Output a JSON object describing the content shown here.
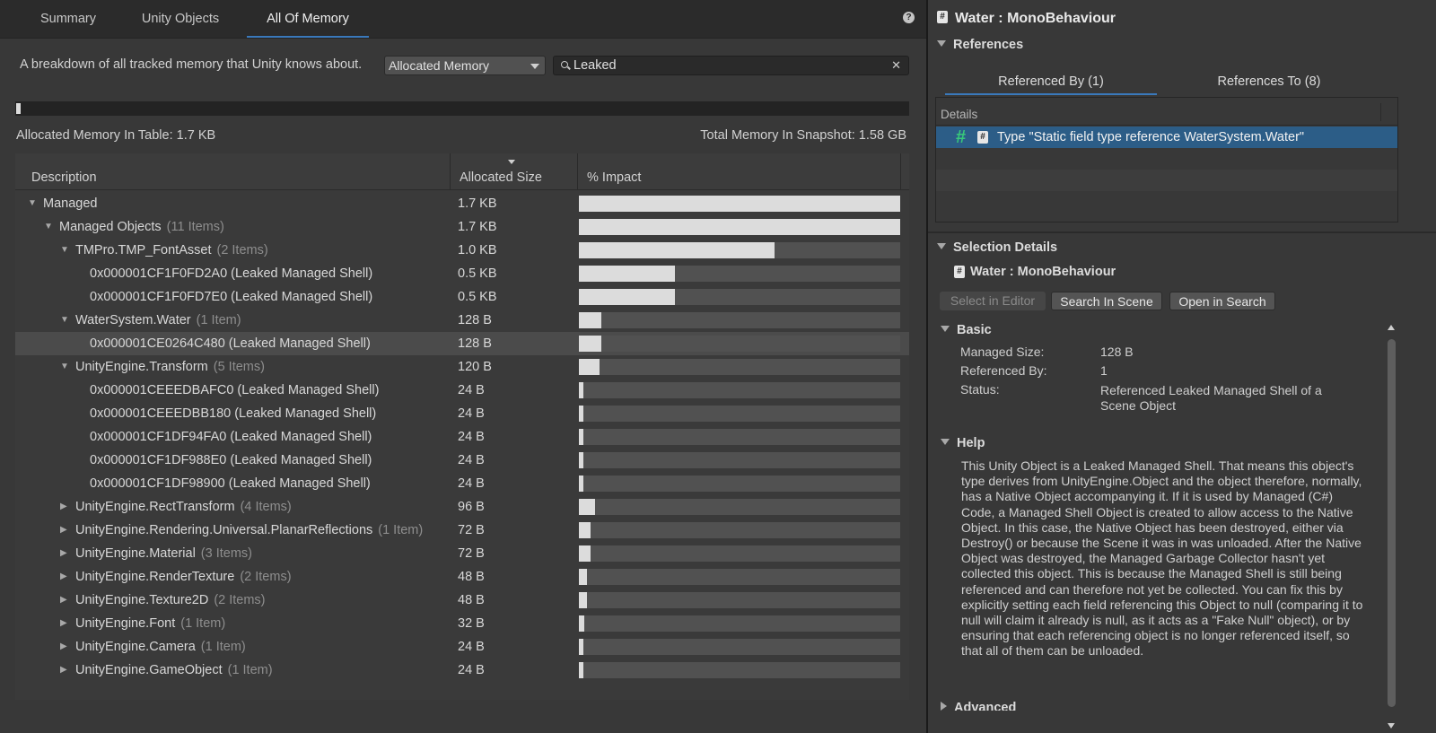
{
  "tabs": [
    {
      "label": "Summary"
    },
    {
      "label": "Unity Objects"
    },
    {
      "label": "All Of Memory"
    }
  ],
  "help_icon": "help-icon",
  "description": "A breakdown of all tracked memory that Unity knows about.",
  "view_dropdown": {
    "value": "Allocated Memory"
  },
  "search": {
    "value": "Leaked",
    "clear": "✕"
  },
  "memory_bar_fraction": 0.0011,
  "summary": {
    "allocated_in_table": "Allocated Memory In Table: 1.7 KB",
    "total_in_snapshot": "Total Memory In Snapshot: 1.58 GB"
  },
  "table": {
    "columns": [
      "Description",
      "Allocated Size",
      "% Impact"
    ],
    "sorted_column": "Allocated Size",
    "rows": [
      {
        "label": "Managed",
        "count": "",
        "size": "1.7 KB",
        "impact": 1.0,
        "depth": 0,
        "expander": "expanded"
      },
      {
        "label": "Managed Objects",
        "count": "(11 Items)",
        "size": "1.7 KB",
        "impact": 1.0,
        "depth": 1,
        "expander": "expanded"
      },
      {
        "label": "TMPro.TMP_FontAsset",
        "count": "(2 Items)",
        "size": "1.0 KB",
        "impact": 0.61,
        "depth": 2,
        "expander": "expanded"
      },
      {
        "label": "0x000001CF1F0FD2A0 (Leaked Managed Shell)",
        "count": "",
        "size": "0.5 KB",
        "impact": 0.3,
        "depth": 3,
        "expander": "none"
      },
      {
        "label": "0x000001CF1F0FD7E0 (Leaked Managed Shell)",
        "count": "",
        "size": "0.5 KB",
        "impact": 0.3,
        "depth": 3,
        "expander": "none"
      },
      {
        "label": "WaterSystem.Water",
        "count": "(1 Item)",
        "size": "128 B",
        "impact": 0.07,
        "depth": 2,
        "expander": "expanded"
      },
      {
        "label": "0x000001CE0264C480 (Leaked Managed Shell)",
        "count": "",
        "size": "128 B",
        "impact": 0.07,
        "depth": 3,
        "expander": "none",
        "selected": true
      },
      {
        "label": "UnityEngine.Transform",
        "count": "(5 Items)",
        "size": "120 B",
        "impact": 0.065,
        "depth": 2,
        "expander": "expanded"
      },
      {
        "label": "0x000001CEEEDBAFC0 (Leaked Managed Shell)",
        "count": "",
        "size": "24 B",
        "impact": 0.014,
        "depth": 3,
        "expander": "none"
      },
      {
        "label": "0x000001CEEEDBB180 (Leaked Managed Shell)",
        "count": "",
        "size": "24 B",
        "impact": 0.014,
        "depth": 3,
        "expander": "none"
      },
      {
        "label": "0x000001CF1DF94FA0 (Leaked Managed Shell)",
        "count": "",
        "size": "24 B",
        "impact": 0.014,
        "depth": 3,
        "expander": "none"
      },
      {
        "label": "0x000001CF1DF988E0 (Leaked Managed Shell)",
        "count": "",
        "size": "24 B",
        "impact": 0.014,
        "depth": 3,
        "expander": "none"
      },
      {
        "label": "0x000001CF1DF98900 (Leaked Managed Shell)",
        "count": "",
        "size": "24 B",
        "impact": 0.014,
        "depth": 3,
        "expander": "none"
      },
      {
        "label": "UnityEngine.RectTransform",
        "count": "(4 Items)",
        "size": "96 B",
        "impact": 0.05,
        "depth": 2,
        "expander": "collapsed"
      },
      {
        "label": "UnityEngine.Rendering.Universal.PlanarReflections",
        "count": "(1 Item)",
        "size": "72 B",
        "impact": 0.036,
        "depth": 2,
        "expander": "collapsed"
      },
      {
        "label": "UnityEngine.Material",
        "count": "(3 Items)",
        "size": "72 B",
        "impact": 0.036,
        "depth": 2,
        "expander": "collapsed"
      },
      {
        "label": "UnityEngine.RenderTexture",
        "count": "(2 Items)",
        "size": "48 B",
        "impact": 0.024,
        "depth": 2,
        "expander": "collapsed"
      },
      {
        "label": "UnityEngine.Texture2D",
        "count": "(2 Items)",
        "size": "48 B",
        "impact": 0.024,
        "depth": 2,
        "expander": "collapsed"
      },
      {
        "label": "UnityEngine.Font",
        "count": "(1 Item)",
        "size": "32 B",
        "impact": 0.017,
        "depth": 2,
        "expander": "collapsed"
      },
      {
        "label": "UnityEngine.Camera",
        "count": "(1 Item)",
        "size": "24 B",
        "impact": 0.014,
        "depth": 2,
        "expander": "collapsed"
      },
      {
        "label": "UnityEngine.GameObject",
        "count": "(1 Item)",
        "size": "24 B",
        "impact": 0.014,
        "depth": 2,
        "expander": "collapsed"
      }
    ]
  },
  "details_panel": {
    "title": "Water : MonoBehaviour",
    "references": {
      "heading": "References",
      "tabs": [
        "Referenced By (1)",
        "References To (8)"
      ],
      "column": "Details",
      "items": [
        "Type \"Static field type reference WaterSystem.Water\""
      ]
    },
    "selection": {
      "heading": "Selection Details",
      "object": "Water : MonoBehaviour",
      "buttons": [
        "Select in Editor",
        "Search In Scene",
        "Open in Search"
      ]
    },
    "basic": {
      "heading": "Basic",
      "rows": [
        {
          "key": "Managed Size:",
          "value": "128 B"
        },
        {
          "key": "Referenced By:",
          "value": "1"
        },
        {
          "key": "Status:",
          "value": "Referenced Leaked Managed Shell of a Scene Object"
        }
      ]
    },
    "help": {
      "heading": "Help",
      "text": "This Unity Object is a Leaked Managed Shell. That means this object's type derives from UnityEngine.Object and the object therefore, normally, has a Native Object accompanying it. If it is used by Managed (C#) Code, a Managed Shell Object is created to allow access to the Native Object. In this case, the Native Object has been destroyed, either via Destroy() or because the Scene it was in was unloaded. After the Native Object was destroyed, the Managed Garbage Collector hasn't yet collected this object. This is because the Managed Shell is still being referenced and can therefore not yet be collected. You can fix this by explicitly setting each field referencing this Object to null (comparing it to null will claim it already is null, as it acts as a \"Fake Null\" object), or by ensuring that each referencing object is no longer referenced itself, so that all of them can be unloaded."
    },
    "advanced": {
      "heading": "Advanced"
    }
  },
  "colors": {
    "accent": "#3a79bb",
    "selection": "#2c5d87",
    "reference_icon": "#38c97a"
  }
}
